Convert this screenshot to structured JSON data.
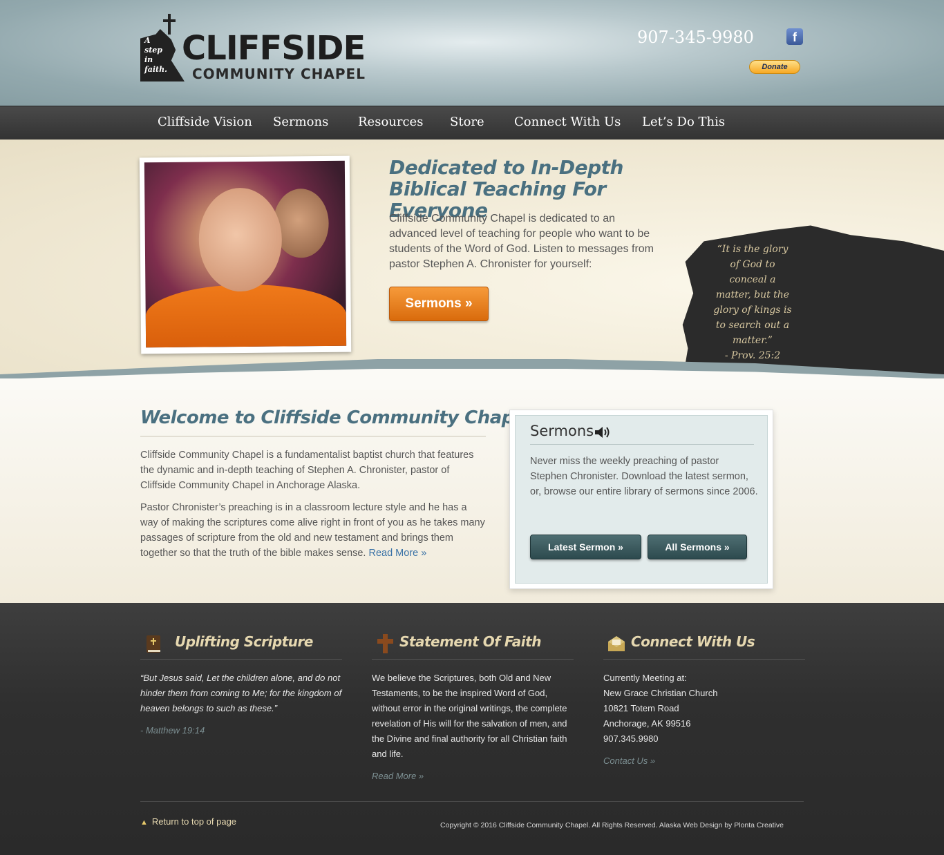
{
  "header": {
    "logo_tagline": [
      "A",
      "step",
      "in",
      "faith."
    ],
    "logo_title": "CLIFFSIDE",
    "logo_subtitle": "COMMUNITY CHAPEL",
    "phone": "907-345-9980",
    "facebook_icon": "facebook-icon",
    "donate_label": "Donate"
  },
  "nav": {
    "items": [
      "Cliffside Vision",
      "Sermons",
      "Resources",
      "Store",
      "Connect With Us",
      "Let’s Do This"
    ]
  },
  "hero": {
    "title_line1": "Dedicated to In-Depth",
    "title_line2": "Biblical Teaching For Everyone",
    "text": "Cliffside Community Chapel is dedicated to an advanced level of teaching for people who want to be students of the Word of God. Listen to messages from pastor Stephen A. Chronister for yourself:",
    "button_label": "Sermons »",
    "verse_lines": [
      "“It is the glory",
      "of God to",
      "conceal a",
      "matter, but the",
      "glory of kings is",
      "to search out a",
      "matter.”",
      "- Prov. 25:2"
    ]
  },
  "welcome": {
    "title": "Welcome to Cliffside Community Chapel",
    "para1": "Cliffside Community Chapel is a fundamentalist baptist church that features the dynamic and in-depth teaching of Stephen A. Chronister, pastor of Cliffside Community Chapel in Anchorage Alaska.",
    "para2": "Pastor Chronister’s preaching is in a classroom lecture style and he has a way of making the scriptures come alive right in front of you as he takes many passages of scripture from the old and new testament and brings them together so that the truth of the bible makes sense.",
    "read_more": "Read More »"
  },
  "sermons_box": {
    "title": "Sermons",
    "icon": "speaker-icon",
    "text": "Never miss the weekly preaching of pastor Stephen Chronister. Download the latest sermon, or, browse our entire library of sermons since 2006.",
    "latest_label": "Latest Sermon »",
    "all_label": "All Sermons »"
  },
  "footer": {
    "scripture": {
      "title": "Uplifting Scripture",
      "icon": "bible-icon",
      "quote": "“But Jesus said, Let the children alone, and do not hinder them from coming to Me; for the kingdom of heaven belongs to such as these.”",
      "ref": "- Matthew 19:14"
    },
    "faith": {
      "title": "Statement Of Faith",
      "icon": "cross-icon",
      "text": "We believe the Scriptures, both Old and New Testaments, to be the inspired Word of God, without error in the original writings, the complete revelation of His will for the salvation of men, and the Divine and final authority for all Christian faith and life.",
      "link": "Read More »"
    },
    "connect": {
      "title": "Connect With Us",
      "icon": "envelope-icon",
      "lines": [
        "Currently Meeting at:",
        "New Grace Christian Church",
        "10821 Totem Road",
        "Anchorage, AK 99516",
        "907.345.9980"
      ],
      "link": "Contact Us »"
    },
    "to_top": "Return to top of page",
    "copyright": "Copyright © 2016 Cliffside Community Chapel. All Rights Reserved. Alaska Web Design by Plonta Creative"
  }
}
